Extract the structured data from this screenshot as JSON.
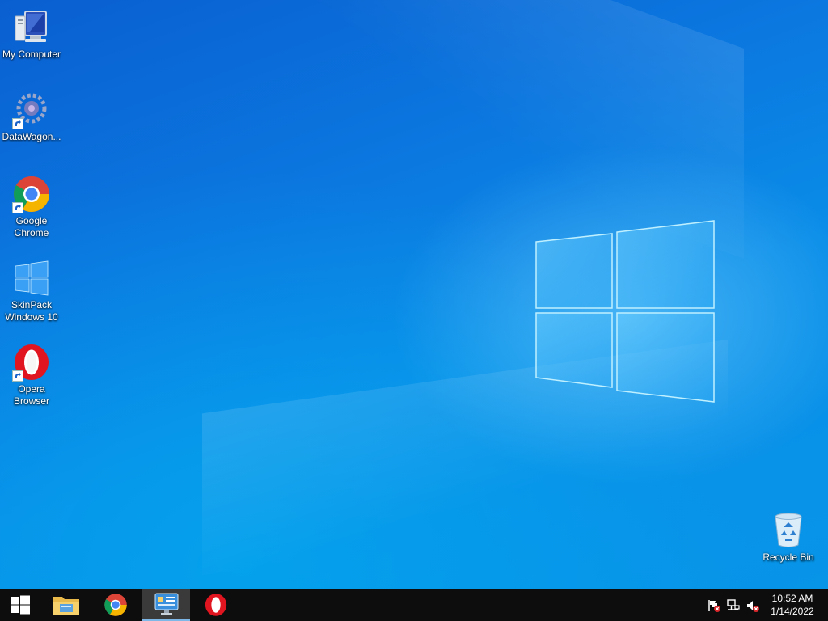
{
  "desktop": {
    "icons": [
      {
        "label": "My Computer"
      },
      {
        "label": "DataWagon..."
      },
      {
        "label": "Google\nChrome"
      },
      {
        "label": "SkinPack\nWindows 10"
      },
      {
        "label": "Opera\nBrowser"
      },
      {
        "label": "Recycle Bin"
      }
    ]
  },
  "taskbar": {
    "clock": {
      "time": "10:52 AM",
      "date": "1/14/2022"
    }
  },
  "colors": {
    "desktop_blue": "#0a78e0",
    "taskbar_bg": "#0d0d0d",
    "accent": "#7db7e8"
  }
}
